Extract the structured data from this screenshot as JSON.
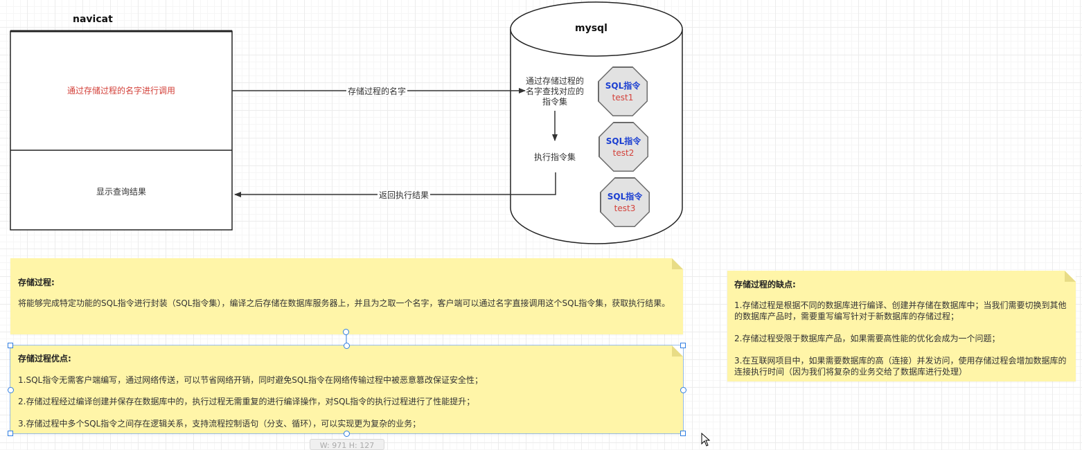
{
  "navicat": {
    "title": "navicat",
    "call_text": "通过存储过程的名字进行调用",
    "result_text": "显示查询结果"
  },
  "mysql": {
    "title": "mysql",
    "lookup_text": "通过存储过程的名字查找对应的指令集",
    "execute_text": "执行指令集",
    "instructions": [
      {
        "title": "SQL指令",
        "name": "test1"
      },
      {
        "title": "SQL指令",
        "name": "test2"
      },
      {
        "title": "SQL指令",
        "name": "test3"
      }
    ]
  },
  "edges": {
    "call_label": "存储过程的名字",
    "return_label": "返回执行结果"
  },
  "notes": {
    "definition": {
      "title": "存储过程:",
      "text": "将能够完成特定功能的SQL指令进行封装（SQL指令集），编译之后存储在数据库服务器上，并且为之取一个名字，客户端可以通过名字直接调用这个SQL指令集，获取执行结果。"
    },
    "advantages": {
      "title": "存储过程优点:",
      "items": [
        "1.SQL指令无需客户端编写，通过网络传送，可以节省网络开销，同时避免SQL指令在网络传输过程中被恶意篡改保证安全性；",
        "2.存储过程经过编译创建并保存在数据库中的，执行过程无需重复的进行编译操作，对SQL指令的执行过程进行了性能提升；",
        "3.存储过程中多个SQL指令之间存在逻辑关系，支持流程控制语句（分支、循环），可以实现更为复杂的业务；"
      ]
    },
    "disadvantages": {
      "title": "存储过程的缺点:",
      "items": [
        "1.存储过程是根据不同的数据库进行编译、创建并存储在数据库中；当我们需要切换到其他的数据库产品时，需要重写编写针对于新数据库的存储过程；",
        "2.存储过程受限于数据库产品，如果需要高性能的优化会成为一个问题；",
        "3.在互联网项目中，如果需要数据库的高（连接）并发访问，使用存储过程会增加数据库的连接执行时间（因为我们将复杂的业务交给了数据库进行处理）"
      ]
    }
  },
  "selection": {
    "size_label": "W: 971  H: 127"
  },
  "colors": {
    "call_text": "#d3413a",
    "sql_title": "#1b3fd1",
    "sql_name": "#d3413a",
    "note_bg": "#fff5a8",
    "selection": "#2f7de1"
  }
}
